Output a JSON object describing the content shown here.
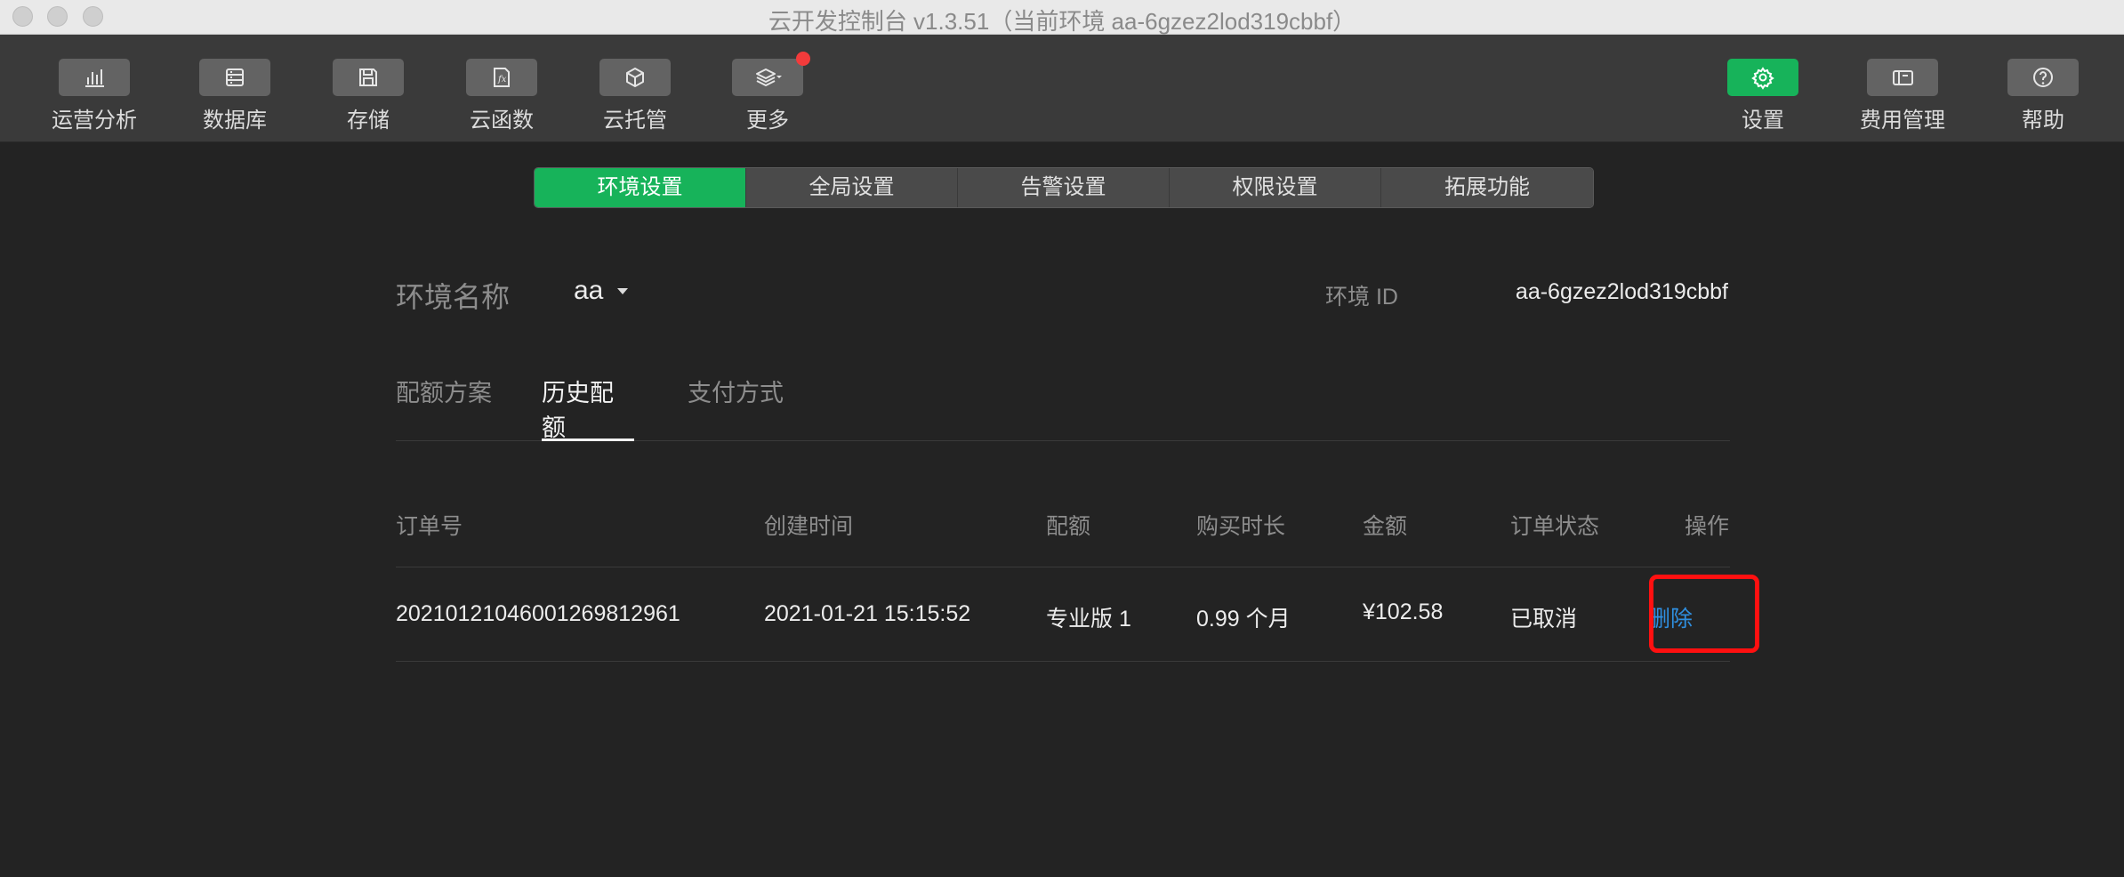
{
  "window": {
    "title": "云开发控制台 v1.3.51（当前环境 aa-6gzez2lod319cbbf）"
  },
  "toolbar": {
    "left_items": [
      {
        "label": "运营分析",
        "icon": "bar-chart-icon"
      },
      {
        "label": "数据库",
        "icon": "database-icon"
      },
      {
        "label": "存储",
        "icon": "save-disk-icon"
      },
      {
        "label": "云函数",
        "icon": "function-icon"
      },
      {
        "label": "云托管",
        "icon": "cube-icon"
      },
      {
        "label": "更多",
        "icon": "layers-icon"
      }
    ],
    "right_items": [
      {
        "label": "设置",
        "icon": "gear-icon",
        "active": true
      },
      {
        "label": "费用管理",
        "icon": "wallet-icon"
      },
      {
        "label": "帮助",
        "icon": "help-icon"
      }
    ],
    "accent_color": "#17b35a",
    "notification_color": "#f23b3b"
  },
  "settings_tabs": {
    "items": [
      "环境设置",
      "全局设置",
      "告警设置",
      "权限设置",
      "拓展功能"
    ],
    "active": "环境设置"
  },
  "environment": {
    "name_label": "环境名称",
    "name_value": "aa",
    "id_label": "环境 ID",
    "id_value": "aa-6gzez2lod319cbbf"
  },
  "sub_tabs": {
    "items": [
      "配额方案",
      "历史配额",
      "支付方式"
    ],
    "active": "历史配额"
  },
  "orders_table": {
    "columns": [
      "订单号",
      "创建时间",
      "配额",
      "购买时长",
      "金额",
      "订单状态",
      "操作"
    ],
    "rows": [
      {
        "order_id": "20210121046001269812961",
        "created_at": "2021-01-21 15:15:52",
        "quota": "专业版 1",
        "duration": "0.99 个月",
        "amount": "¥102.58",
        "status": "已取消",
        "action": "删除"
      }
    ],
    "link_color": "#2f8fe0",
    "highlight_color": "#ff1010"
  }
}
